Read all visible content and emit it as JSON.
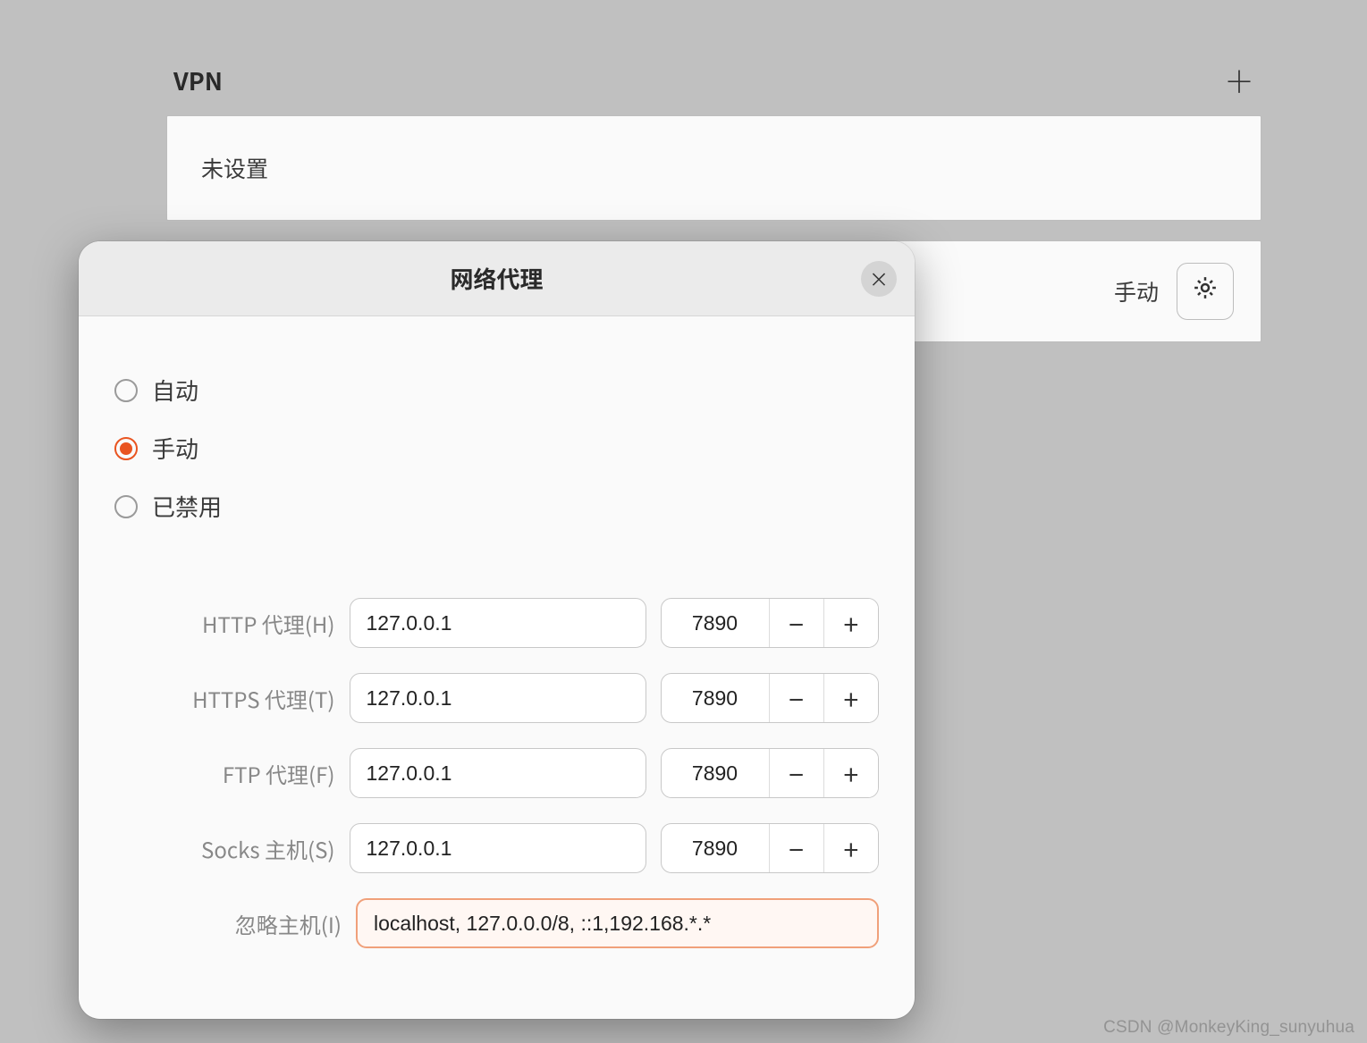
{
  "vpn": {
    "section_title": "VPN",
    "not_set": "未设置",
    "proxy_status": "手动"
  },
  "dialog": {
    "title": "网络代理",
    "radios": {
      "auto": "自动",
      "manual": "手动",
      "disabled": "已禁用"
    },
    "fields": {
      "http": {
        "label": "HTTP 代理(H)",
        "host": "127.0.0.1",
        "port": "7890"
      },
      "https": {
        "label": "HTTPS 代理(T)",
        "host": "127.0.0.1",
        "port": "7890"
      },
      "ftp": {
        "label": "FTP 代理(F)",
        "host": "127.0.0.1",
        "port": "7890"
      },
      "socks": {
        "label": "Socks 主机(S)",
        "host": "127.0.0.1",
        "port": "7890"
      },
      "ignore": {
        "label": "忽略主机(I)",
        "value": "localhost, 127.0.0.0/8, ::1,192.168.*.*"
      }
    },
    "spin": {
      "minus": "−",
      "plus": "+"
    },
    "close": "×"
  },
  "watermark": "CSDN @MonkeyKing_sunyuhua"
}
